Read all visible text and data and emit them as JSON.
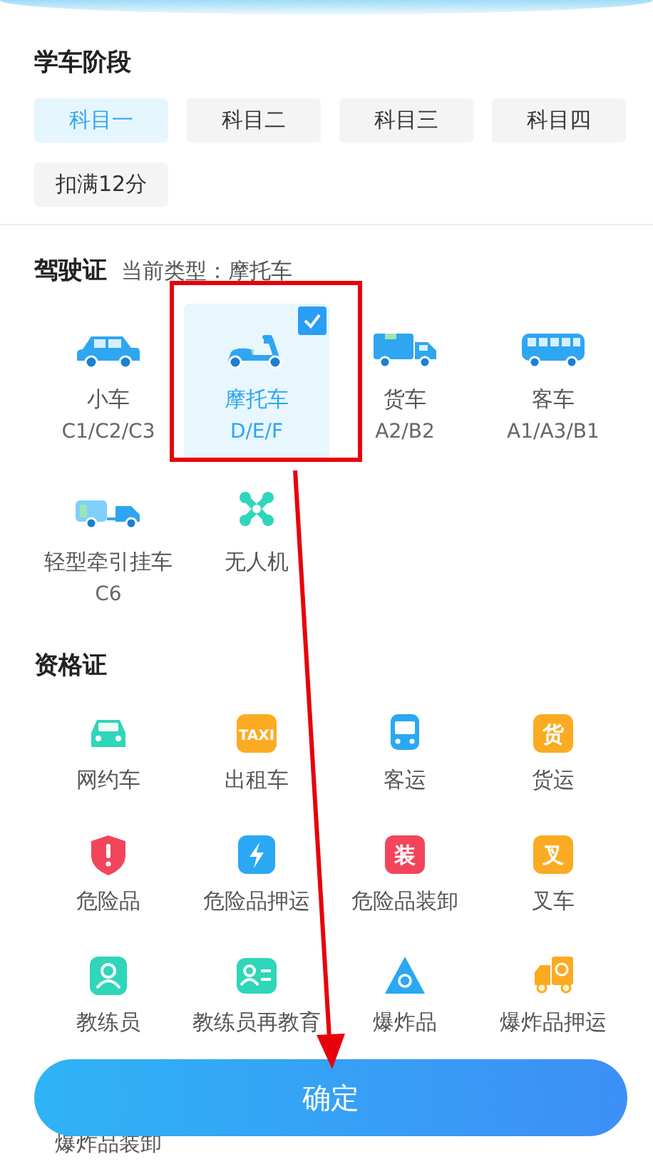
{
  "stage": {
    "title": "学车阶段",
    "options": [
      {
        "label": "科目一",
        "selected": true
      },
      {
        "label": "科目二",
        "selected": false
      },
      {
        "label": "科目三",
        "selected": false
      },
      {
        "label": "科目四",
        "selected": false
      },
      {
        "label": "扣满12分",
        "selected": false
      }
    ]
  },
  "license": {
    "title": "驾驶证",
    "current": "当前类型：摩托车",
    "items": [
      {
        "kind": "car",
        "name": "小车",
        "code": "C1/C2/C3",
        "selected": false
      },
      {
        "kind": "scooter",
        "name": "摩托车",
        "code": "D/E/F",
        "selected": true
      },
      {
        "kind": "truck",
        "name": "货车",
        "code": "A2/B2",
        "selected": false
      },
      {
        "kind": "bus",
        "name": "客车",
        "code": "A1/A3/B1",
        "selected": false
      },
      {
        "kind": "trailer",
        "name": "轻型牵引挂车",
        "code": "C6",
        "selected": false
      },
      {
        "kind": "drone",
        "name": "无人机",
        "selected": false
      }
    ]
  },
  "certificates": {
    "title": "资格证",
    "items": [
      {
        "kind": "car",
        "name": "网约车",
        "color": "#2fd6b9"
      },
      {
        "kind": "glyph",
        "glyph": "TAXI",
        "name": "出租车",
        "color": "#fbab22"
      },
      {
        "kind": "bus",
        "name": "客运",
        "color": "#2aa8f4"
      },
      {
        "kind": "glyph",
        "glyph": "货",
        "name": "货运",
        "color": "#fbab22"
      },
      {
        "kind": "shield",
        "name": "危险品",
        "color": "#f2455c"
      },
      {
        "kind": "bolt",
        "name": "危险品押运",
        "color": "#2aa8f4"
      },
      {
        "kind": "glyph",
        "glyph": "装",
        "name": "危险品装卸",
        "color": "#f2455c"
      },
      {
        "kind": "glyph",
        "glyph": "叉",
        "name": "叉车",
        "color": "#fbab22"
      },
      {
        "kind": "person",
        "name": "教练员",
        "color": "#2fd6b9"
      },
      {
        "kind": "idcard",
        "name": "教练员再教育",
        "color": "#2fd6b9"
      },
      {
        "kind": "triangle",
        "name": "爆炸品",
        "color": "#2aa8f4"
      },
      {
        "kind": "firetruck",
        "name": "爆炸品押运",
        "color": "#fbab22"
      },
      {
        "name": "爆炸品装卸"
      }
    ]
  },
  "confirm": {
    "label": "确定"
  },
  "annotation": {
    "highlight": true,
    "arrow": true
  }
}
